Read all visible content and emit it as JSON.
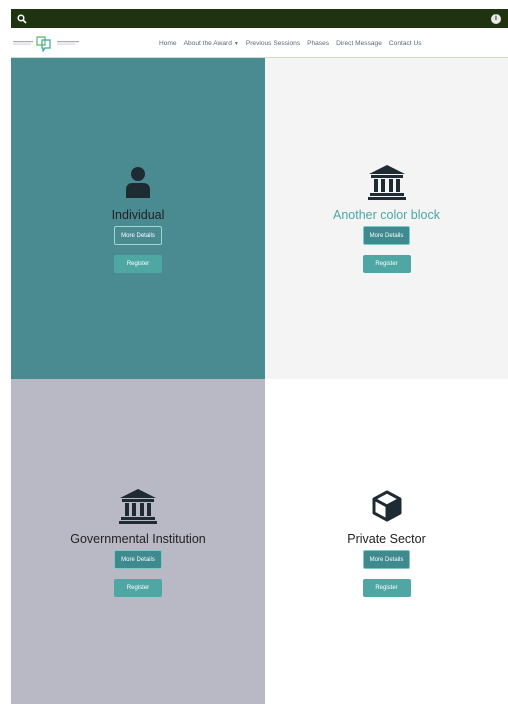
{
  "topbar": {
    "search_icon": "search-icon",
    "info_icon": "info-icon",
    "info_glyph": "i"
  },
  "nav": {
    "items": [
      {
        "label": "Home"
      },
      {
        "label": "About the Award",
        "dropdown": true
      },
      {
        "label": "Previous Sessions"
      },
      {
        "label": "Phases"
      },
      {
        "label": "Direct Message"
      },
      {
        "label": "Contact Us"
      }
    ]
  },
  "blocks": [
    {
      "title": "Individual",
      "icon": "person-icon",
      "details_label": "More Details",
      "register_label": "Register",
      "color": "#4a8b91"
    },
    {
      "title": "Another color block",
      "icon": "institution-icon",
      "details_label": "More Details",
      "register_label": "Register",
      "color": "#f4f4f4"
    },
    {
      "title": "Governmental Institution",
      "icon": "institution-icon",
      "details_label": "More Details",
      "register_label": "Register",
      "color": "#b9b8c5"
    },
    {
      "title": "Private Sector",
      "icon": "cube-icon",
      "details_label": "More Details",
      "register_label": "Register",
      "color": "#ffffff"
    }
  ],
  "colors": {
    "topbar": "#1f3311",
    "accent": "#4fa7a4",
    "button_dark": "#3e8a8e"
  }
}
